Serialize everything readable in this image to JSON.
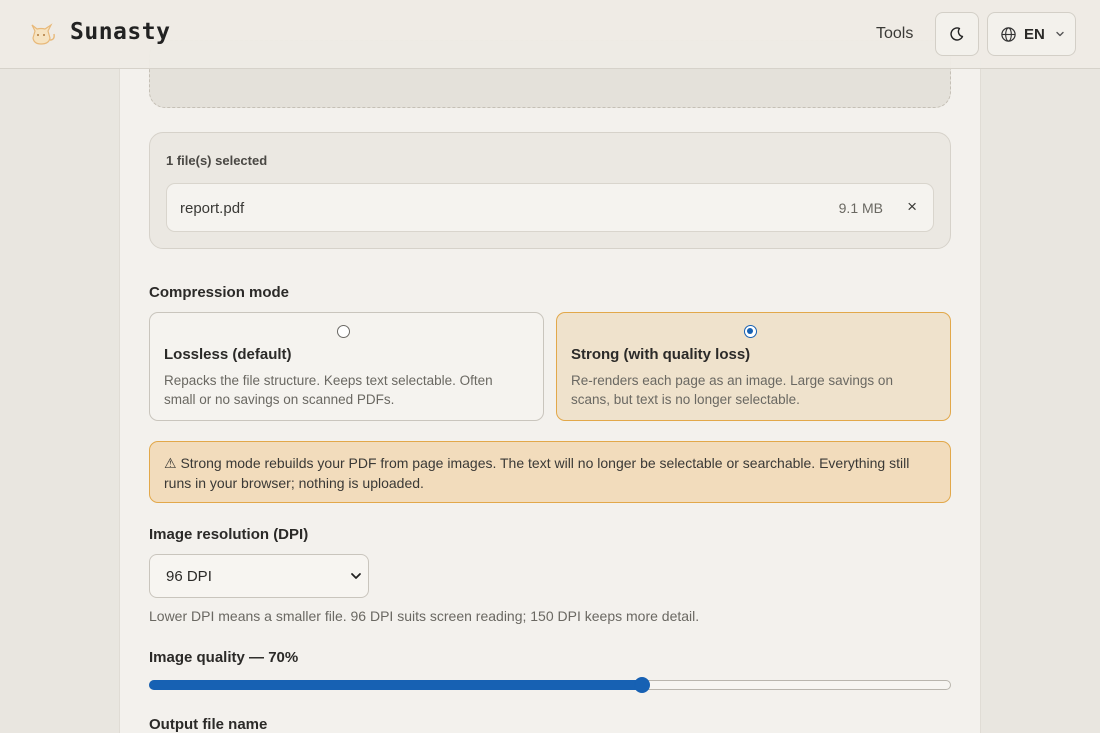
{
  "header": {
    "brand": "Sunasty",
    "tools_label": "Tools",
    "language": "EN",
    "icons": {
      "logo": "cat-logo-icon",
      "theme": "moon-icon",
      "language": "globe-icon",
      "dropdown": "chevron-down-icon"
    }
  },
  "files": {
    "selected_label": "1 file(s) selected",
    "items": [
      {
        "name": "report.pdf",
        "size": "9.1 MB",
        "remove_label": "×"
      }
    ]
  },
  "compression": {
    "label": "Compression mode",
    "options": [
      {
        "title": "Lossless (default)",
        "description": "Repacks the file structure. Keeps text selectable. Often small or no savings on scanned PDFs.",
        "selected": false
      },
      {
        "title": "Strong (with quality loss)",
        "description": "Re-renders each page as an image. Large savings on scans, but text is no longer selectable.",
        "selected": true
      }
    ],
    "warning": "⚠ Strong mode rebuilds your PDF from page images. The text will no longer be selectable or searchable. Everything still runs in your browser; nothing is uploaded."
  },
  "resolution": {
    "label": "Image resolution (DPI)",
    "selected": "96 DPI",
    "hint": "Lower DPI means a smaller file. 96 DPI suits screen reading; 150 DPI keeps more detail."
  },
  "quality": {
    "label": "Image quality — 70%",
    "value_percent": 70,
    "slider_fraction": 0.615
  },
  "output": {
    "label": "Output file name"
  },
  "colors": {
    "accent": "#1761b3",
    "warning_bg": "#f2dcbc",
    "warning_border": "#e2a84a",
    "selected_card_bg": "#efe2cc"
  }
}
